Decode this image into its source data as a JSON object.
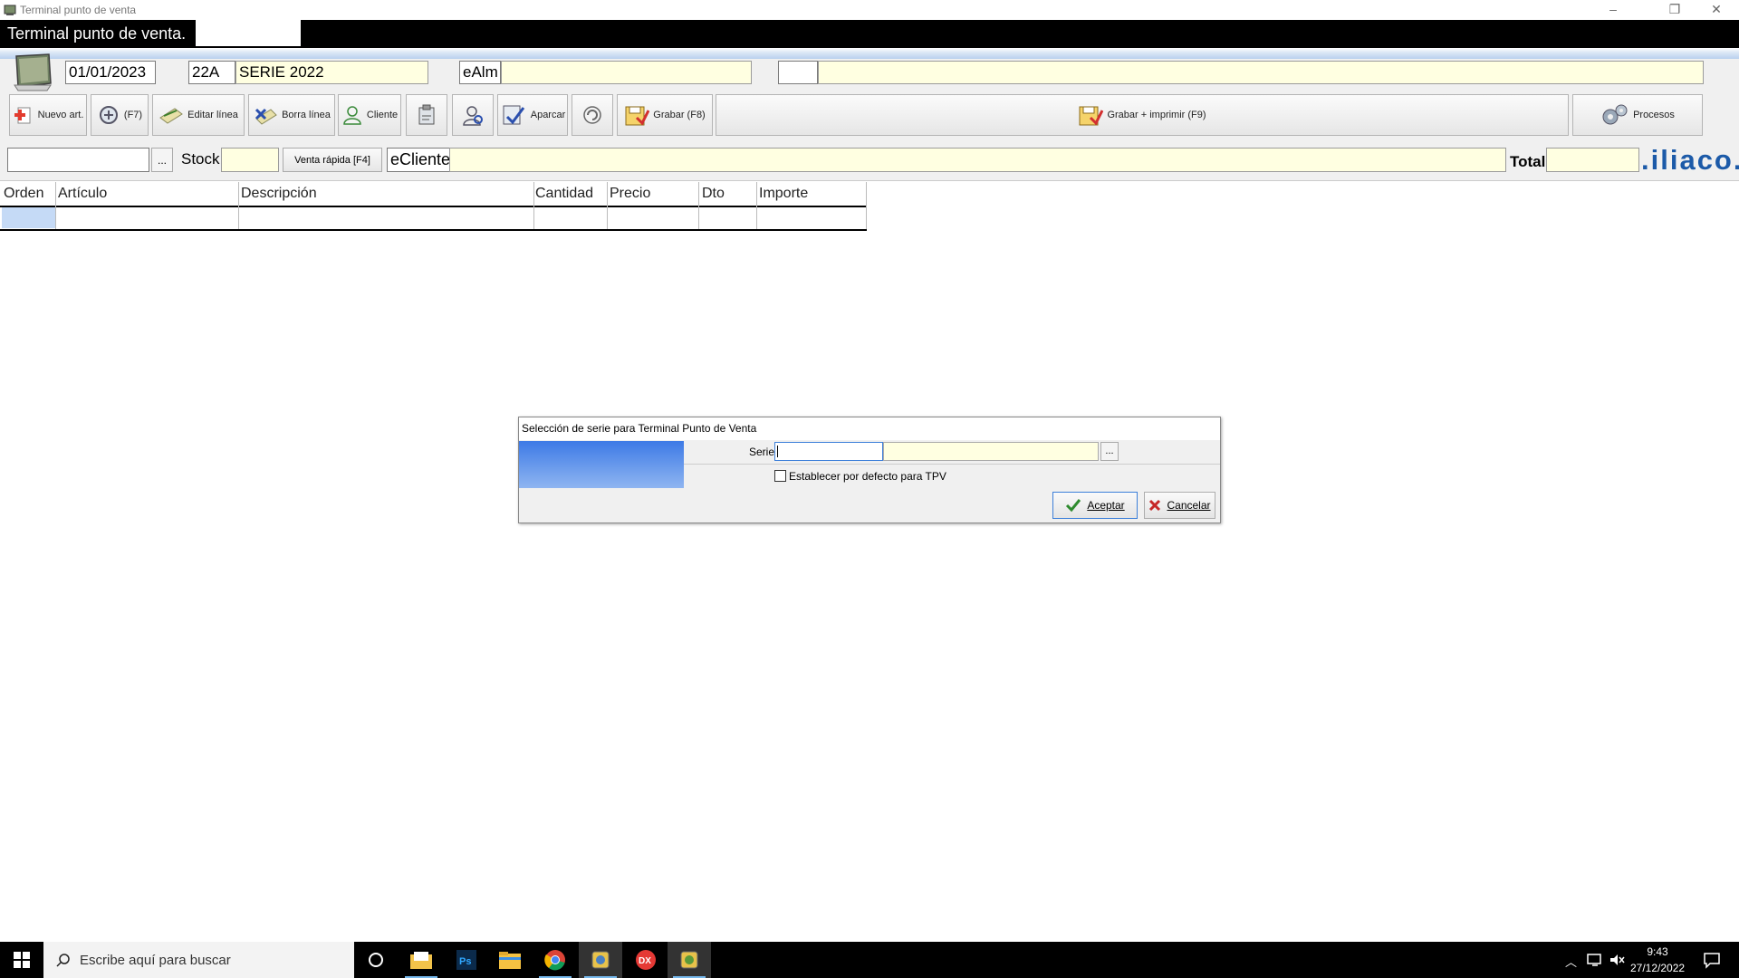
{
  "window": {
    "title": "Terminal punto de venta",
    "header_title": "Terminal punto de venta."
  },
  "doc": {
    "date": "01/01/2023",
    "serie_code": "22A",
    "serie_name": "SERIE 2022",
    "almacen": "eAlm",
    "article_code": "",
    "stock_label": "Stock",
    "cliente": "eCliente",
    "total_label": "Total",
    "logo_text": ".iliaco."
  },
  "toolbar": {
    "nuevo": "Nuevo art.",
    "f7": "(F7)",
    "editar": "Editar línea",
    "borrar": "Borra línea",
    "cliente": "Cliente",
    "aparcar": "Aparcar",
    "grabar": "Grabar (F8)",
    "grabar_imprimir": "Grabar + imprimir (F9)",
    "procesos": "Procesos",
    "browse": "...",
    "venta_rapida": "Venta rápida [F4]"
  },
  "table": {
    "columns": [
      "Orden",
      "Artículo",
      "Descripción",
      "Cantidad",
      "Precio",
      "Dto",
      "Importe"
    ]
  },
  "dialog": {
    "title": "Selección de serie para Terminal Punto de Venta",
    "serie_label": "Serie",
    "serie_value": "",
    "browse": "...",
    "checkbox_label": "Establecer por defecto para TPV",
    "accept": "Aceptar",
    "cancel": "Cancelar"
  },
  "taskbar": {
    "search_placeholder": "Escribe aquí para buscar",
    "time": "9:43",
    "date": "27/12/2022"
  },
  "colors": {
    "accent_yellow": "#ffffe1",
    "header_black": "#000000",
    "selection_blue": "#c5daf6",
    "dialog_gradient": "#4d86e8",
    "logo_blue": "#1c5aa8"
  }
}
